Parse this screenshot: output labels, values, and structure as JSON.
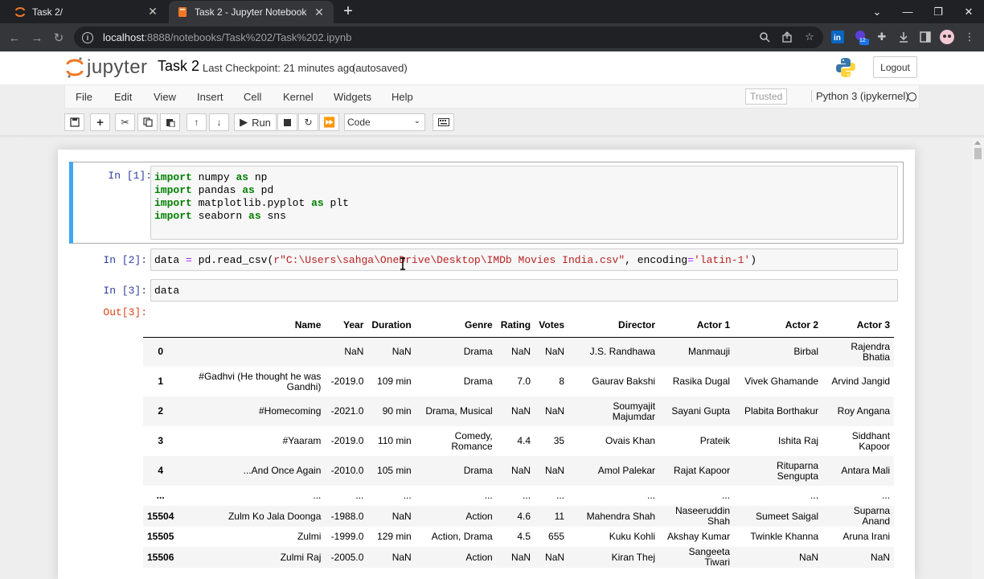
{
  "browser": {
    "tabs": [
      {
        "title": "Task 2/",
        "active": false
      },
      {
        "title": "Task 2 - Jupyter Notebook",
        "active": true
      }
    ],
    "url_host": "localhost",
    "url_rest": ":8888/notebooks/Task%202/Task%202.ipynb",
    "ext_badge": "12"
  },
  "header": {
    "logo_text": "jupyter",
    "notebook_name": "Task 2",
    "checkpoint": "Last Checkpoint: 21 minutes ago",
    "autosave": "(autosaved)",
    "logout": "Logout"
  },
  "menu": {
    "items": [
      "File",
      "Edit",
      "View",
      "Insert",
      "Cell",
      "Kernel",
      "Widgets",
      "Help"
    ],
    "trusted": "Trusted",
    "kernel": "Python 3 (ipykernel)"
  },
  "toolbar": {
    "run_label": "Run",
    "cell_type": "Code"
  },
  "cells": {
    "c1_prompt": "In [1]:",
    "c2_prompt": "In [2]:",
    "c3_prompt": "In [3]:",
    "c3_out_prompt": "Out[3]:",
    "c2_var": "data",
    "c2_eq": "=",
    "c2_call": "pd.read_csv(",
    "c2_path": "r\"C:\\Users\\sahga\\OneDrive\\Desktop\\IMDb Movies India.csv\"",
    "c2_kw": ", encoding",
    "c2_kwval": "'latin-1'",
    "c2_close": ")",
    "c3_code": "data",
    "imports": [
      {
        "kw": "import",
        "mod": "numpy",
        "as": "as",
        "alias": "np"
      },
      {
        "kw": "import",
        "mod": "pandas",
        "as": "as",
        "alias": "pd"
      },
      {
        "kw": "import",
        "mod": "matplotlib.pyplot",
        "as": "as",
        "alias": "plt"
      },
      {
        "kw": "import",
        "mod": "seaborn",
        "as": "as",
        "alias": "sns"
      }
    ]
  },
  "dataframe": {
    "columns": [
      "",
      "Name",
      "Year",
      "Duration",
      "Genre",
      "Rating",
      "Votes",
      "Director",
      "Actor 1",
      "Actor 2",
      "Actor 3"
    ],
    "rows": [
      [
        "0",
        "",
        "NaN",
        "NaN",
        "Drama",
        "NaN",
        "NaN",
        "J.S. Randhawa",
        "Manmauji",
        "Birbal",
        "Rajendra Bhatia"
      ],
      [
        "1",
        "#Gadhvi (He thought he was Gandhi)",
        "-2019.0",
        "109 min",
        "Drama",
        "7.0",
        "8",
        "Gaurav Bakshi",
        "Rasika Dugal",
        "Vivek Ghamande",
        "Arvind Jangid"
      ],
      [
        "2",
        "#Homecoming",
        "-2021.0",
        "90 min",
        "Drama, Musical",
        "NaN",
        "NaN",
        "Soumyajit Majumdar",
        "Sayani Gupta",
        "Plabita Borthakur",
        "Roy Angana"
      ],
      [
        "3",
        "#Yaaram",
        "-2019.0",
        "110 min",
        "Comedy, Romance",
        "4.4",
        "35",
        "Ovais Khan",
        "Prateik",
        "Ishita Raj",
        "Siddhant Kapoor"
      ],
      [
        "4",
        "...And Once Again",
        "-2010.0",
        "105 min",
        "Drama",
        "NaN",
        "NaN",
        "Amol Palekar",
        "Rajat Kapoor",
        "Rituparna Sengupta",
        "Antara Mali"
      ],
      [
        "...",
        "...",
        "...",
        "...",
        "...",
        "...",
        "...",
        "...",
        "...",
        "...",
        "..."
      ],
      [
        "15504",
        "Zulm Ko Jala Doonga",
        "-1988.0",
        "NaN",
        "Action",
        "4.6",
        "11",
        "Mahendra Shah",
        "Naseeruddin Shah",
        "Sumeet Saigal",
        "Suparna Anand"
      ],
      [
        "15505",
        "Zulmi",
        "-1999.0",
        "129 min",
        "Action, Drama",
        "4.5",
        "655",
        "Kuku Kohli",
        "Akshay Kumar",
        "Twinkle Khanna",
        "Aruna Irani"
      ],
      [
        "15506",
        "Zulmi Raj",
        "-2005.0",
        "NaN",
        "Action",
        "NaN",
        "NaN",
        "Kiran Thej",
        "Sangeeta Tiwari",
        "NaN",
        "NaN"
      ]
    ]
  },
  "colors": {
    "selected_cell_border": "#42a5f5",
    "in_prompt": "#303f9f",
    "out_prompt": "#d84315",
    "keyword": "#008000",
    "string": "#ba2121"
  }
}
